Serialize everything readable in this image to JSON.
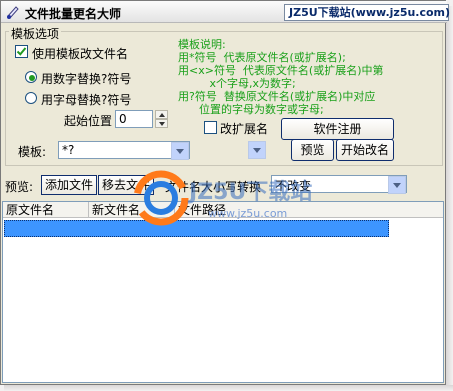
{
  "window": {
    "title": "文件批量更名大师",
    "site_text": "JZ5U下载站(www.jz5u.com)"
  },
  "template_options": {
    "group_title": "模板选项",
    "use_template_label": "使用模板改文件名",
    "use_template_checked": true,
    "radio_digits_label": "用数字替换?符号",
    "radio_letters_label": "用字母替换?符号",
    "selected_radio": "digits",
    "start_label": "起始位置",
    "start_value": "0"
  },
  "help": {
    "lines": [
      "模板说明:",
      "用*符号  代表原文件名(或扩展名);",
      "用<x>符号  代表原文件名(或扩展名)中第",
      "         x个字母,x为数字;",
      "用?符号  替换原文件名(或扩展名)中对应",
      "      位置的字母为数字或字母;"
    ]
  },
  "extension": {
    "label": "改扩展名",
    "checked": false
  },
  "template": {
    "label": "模板:",
    "value": "*?"
  },
  "buttons": {
    "register": "软件注册",
    "preview": "预览",
    "start": "开始改名",
    "add_files": "添加文件",
    "remove_files": "移去文件"
  },
  "preview": {
    "label": "预览:",
    "case_label": "文件名大小写转换",
    "case_value": "不改变"
  },
  "table": {
    "columns": [
      "原文件名",
      "新文件名",
      "文件路径"
    ]
  },
  "watermark": {
    "brand": "JZ5U下载站",
    "url": "www.jz5u.com"
  },
  "colors": {
    "title_green": "#1aa01a",
    "selection_blue": "#3d95ff"
  }
}
